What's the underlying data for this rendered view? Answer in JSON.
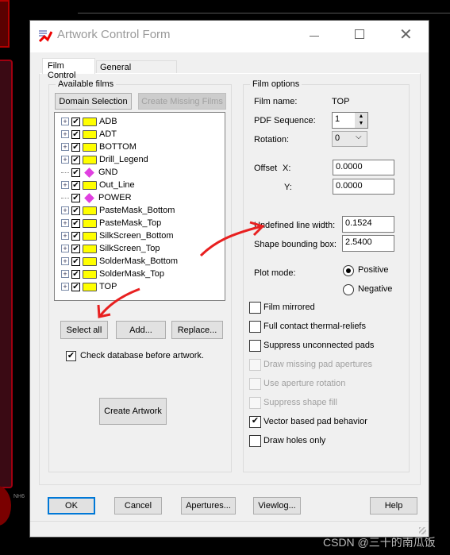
{
  "window": {
    "title": "Artwork Control Form"
  },
  "tabs": [
    {
      "label": "Film Control",
      "active": true
    },
    {
      "label": "General Parameters",
      "active": false
    }
  ],
  "available_films": {
    "legend": "Available films",
    "domain_selection": "Domain Selection",
    "create_missing": "Create Missing Films",
    "films": [
      {
        "name": "ADB",
        "icon": "folder",
        "checked": true
      },
      {
        "name": "ADT",
        "icon": "folder",
        "checked": true
      },
      {
        "name": "BOTTOM",
        "icon": "folder",
        "checked": true
      },
      {
        "name": "Drill_Legend",
        "icon": "folder",
        "checked": true
      },
      {
        "name": "GND",
        "icon": "diamond",
        "checked": true
      },
      {
        "name": "Out_Line",
        "icon": "folder",
        "checked": true
      },
      {
        "name": "POWER",
        "icon": "diamond",
        "checked": true
      },
      {
        "name": "PasteMask_Bottom",
        "icon": "folder",
        "checked": true
      },
      {
        "name": "PasteMask_Top",
        "icon": "folder",
        "checked": true
      },
      {
        "name": "SilkScreen_Bottom",
        "icon": "folder",
        "checked": true
      },
      {
        "name": "SilkScreen_Top",
        "icon": "folder",
        "checked": true
      },
      {
        "name": "SolderMask_Bottom",
        "icon": "folder",
        "checked": true
      },
      {
        "name": "SolderMask_Top",
        "icon": "folder",
        "checked": true
      },
      {
        "name": "TOP",
        "icon": "folder",
        "checked": true
      }
    ],
    "select_all": "Select all",
    "add": "Add...",
    "replace": "Replace...",
    "check_db": "Check database before artwork.",
    "check_db_checked": true,
    "create_artwork": "Create Artwork"
  },
  "film_options": {
    "legend": "Film options",
    "film_name_label": "Film name:",
    "film_name": "TOP",
    "pdf_label": "PDF Sequence:",
    "pdf_value": "1",
    "rotation_label": "Rotation:",
    "rotation_value": "0",
    "offset_label": "Offset",
    "x_label": "X:",
    "x_value": "0.0000",
    "y_label": "Y:",
    "y_value": "0.0000",
    "undef_label": "Undefined line width:",
    "undef_value": "0.1524",
    "shape_label": "Shape bounding box:",
    "shape_value": "2.5400",
    "plot_label": "Plot mode:",
    "positive": "Positive",
    "negative": "Negative",
    "plot_mode": "Positive",
    "checks": [
      {
        "label": "Film mirrored",
        "checked": false,
        "enabled": true
      },
      {
        "label": "Full contact thermal-reliefs",
        "checked": false,
        "enabled": true
      },
      {
        "label": "Suppress unconnected pads",
        "checked": false,
        "enabled": true
      },
      {
        "label": "Draw missing pad apertures",
        "checked": false,
        "enabled": false
      },
      {
        "label": "Use aperture rotation",
        "checked": false,
        "enabled": false
      },
      {
        "label": "Suppress shape fill",
        "checked": false,
        "enabled": false
      },
      {
        "label": "Vector based pad behavior",
        "checked": true,
        "enabled": true
      },
      {
        "label": "Draw holes only",
        "checked": false,
        "enabled": true
      }
    ]
  },
  "footer": {
    "ok": "OK",
    "cancel": "Cancel",
    "apertures": "Apertures...",
    "viewlog": "Viewlog...",
    "help": "Help"
  },
  "background": {
    "pcb_label": "NH6",
    "watermark": "CSDN @三十的南瓜饭"
  },
  "colors": {
    "annotation_arrow": "#e82020",
    "focus": "#0078d7"
  }
}
